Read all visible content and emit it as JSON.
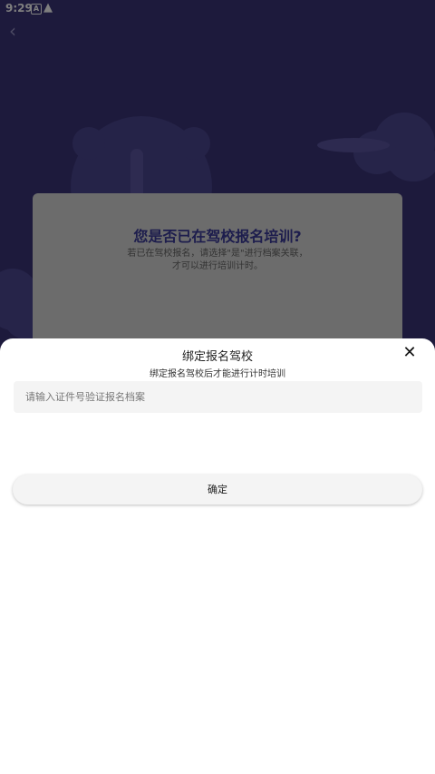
{
  "status_bar": {
    "time": "9:29",
    "icon_a": "A",
    "icons": [
      "notification-a-icon",
      "warning-icon"
    ]
  },
  "background": {
    "color": "#3a3478",
    "card_title": "您是否已在驾校报名培训?",
    "card_text_line1": "若已在驾校报名，请选择\"是\"进行档案关联，",
    "card_text_line2": "才可以进行培训计时。"
  },
  "sheet": {
    "title": "绑定报名驾校",
    "subtitle": "绑定报名驾校后才能进行计时培训",
    "input": {
      "value": "",
      "placeholder": "请输入证件号验证报名档案"
    },
    "confirm_label": "确定"
  },
  "colors": {
    "accent_title": "#3b3a9a",
    "overlay": "rgba(0,0,0,0.5)"
  }
}
